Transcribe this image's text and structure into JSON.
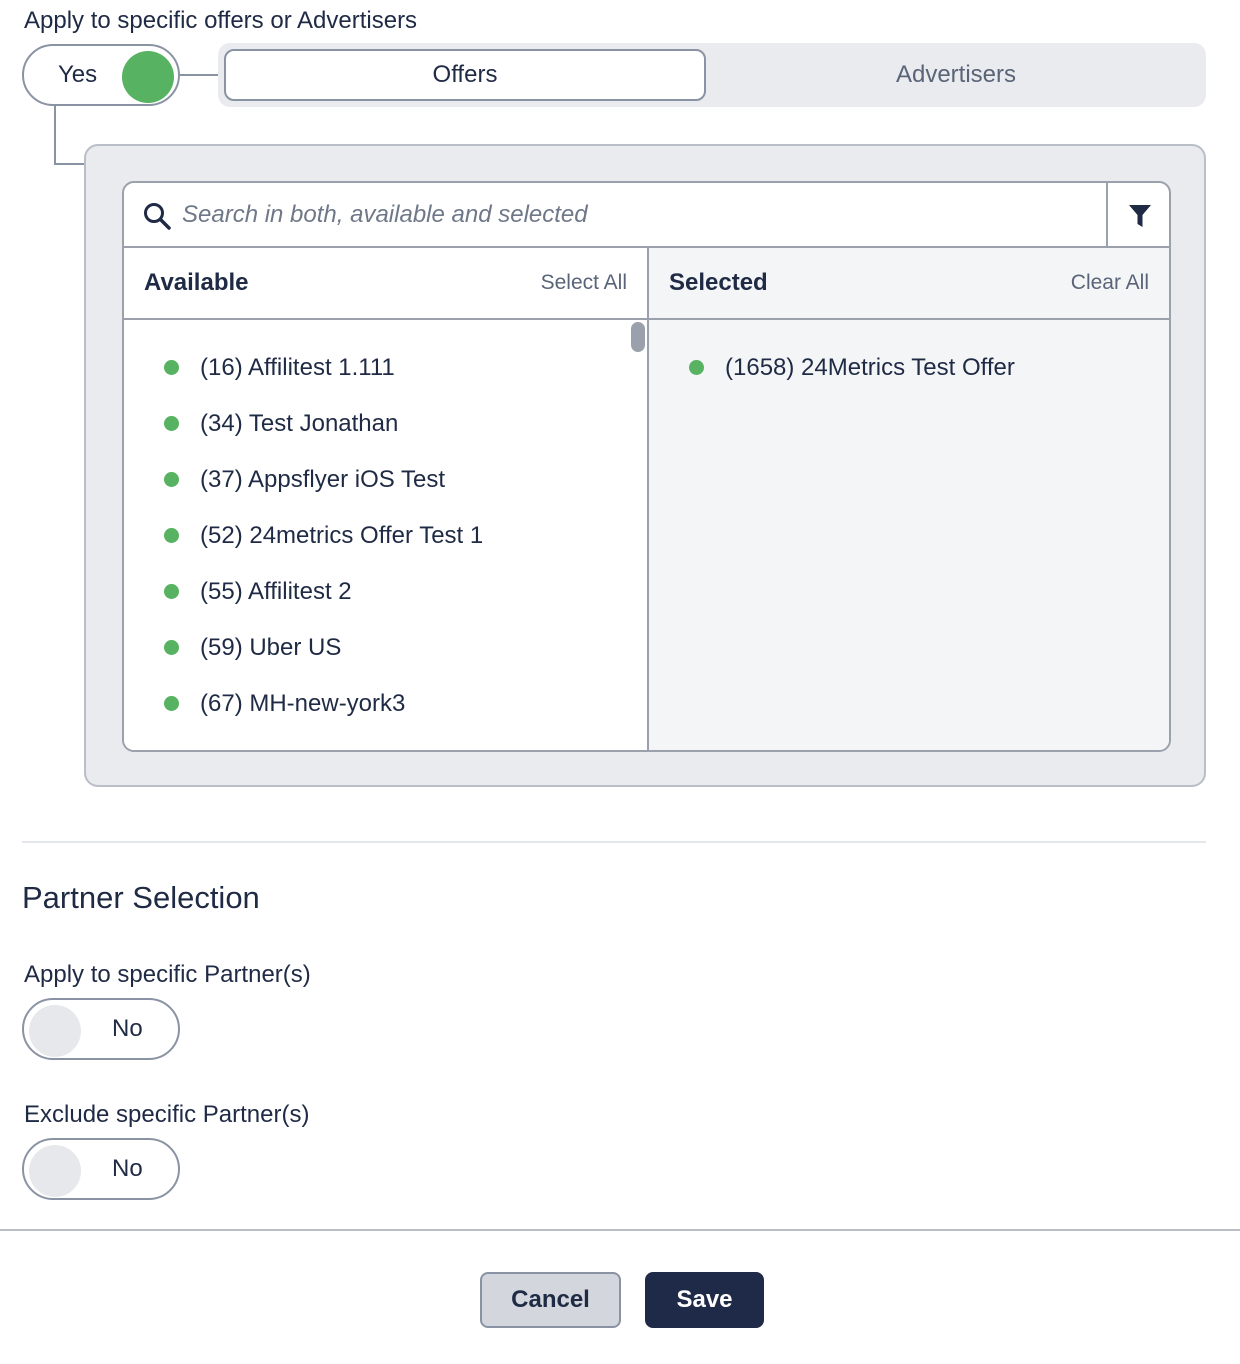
{
  "offers_section": {
    "label": "Apply to specific offers or Advertisers",
    "toggle_label": "Yes",
    "tabs": [
      {
        "label": "Offers",
        "active": true
      },
      {
        "label": "Advertisers",
        "active": false
      }
    ]
  },
  "picker": {
    "search_placeholder": "Search in both, available and selected",
    "search_value": "",
    "filter_icon": "filter-icon",
    "available": {
      "title": "Available",
      "action": "Select All",
      "items": [
        "(16) Affilitest 1.111",
        "(34) Test Jonathan",
        "(37) Appsflyer iOS Test",
        "(52) 24metrics Offer Test 1",
        "(55) Affilitest 2",
        "(59) Uber US",
        "(67) MH-new-york3"
      ]
    },
    "selected": {
      "title": "Selected",
      "action": "Clear All",
      "items": [
        "(1658) 24Metrics Test Offer"
      ]
    },
    "status_color": "#57b262"
  },
  "partner_section": {
    "title": "Partner Selection",
    "apply_label": "Apply to specific Partner(s)",
    "apply_toggle": "No",
    "exclude_label": "Exclude specific Partner(s)",
    "exclude_toggle": "No"
  },
  "footer": {
    "cancel_label": "Cancel",
    "save_label": "Save"
  },
  "colors": {
    "accent_green": "#57b262",
    "primary_navy": "#1e2a47"
  }
}
